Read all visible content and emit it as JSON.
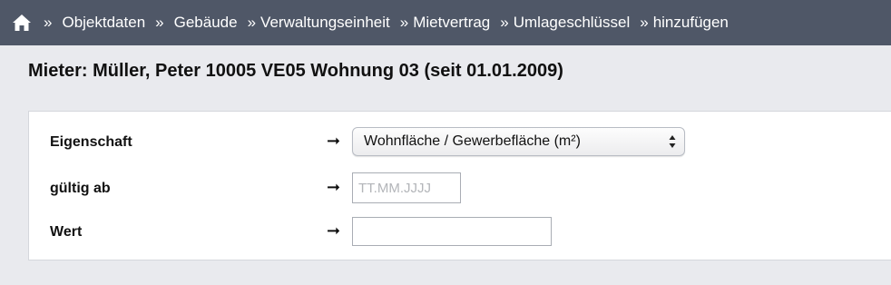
{
  "breadcrumb": {
    "home_icon": "home-icon",
    "separator": "»",
    "items": [
      {
        "label": "Objektdaten"
      },
      {
        "label": "Gebäude"
      },
      {
        "label": "Verwaltungseinheit"
      },
      {
        "label": "Mietvertrag"
      },
      {
        "label": "Umlageschlüssel"
      },
      {
        "label": "hinzufügen"
      }
    ]
  },
  "page": {
    "title": "Mieter: Müller, Peter 10005 VE05 Wohnung 03 (seit 01.01.2009)"
  },
  "form": {
    "arrow": "➞",
    "eigenschaft": {
      "label": "Eigenschaft",
      "selected_value": "Wohnfläche / Gewerbefläche (m²)"
    },
    "gueltig_ab": {
      "label": "gültig ab",
      "value": "",
      "placeholder": "TT.MM.JJJJ"
    },
    "wert": {
      "label": "Wert",
      "value": ""
    }
  },
  "colors": {
    "topbar": "#4f5767",
    "background": "#e9eaee",
    "panel": "#ffffff"
  }
}
